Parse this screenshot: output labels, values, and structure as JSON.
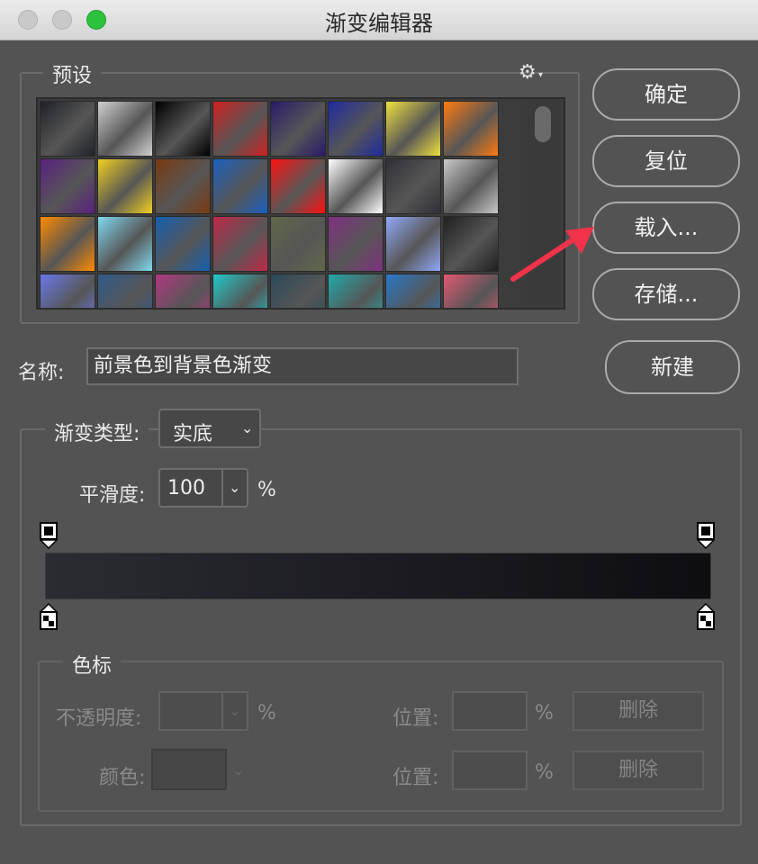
{
  "window": {
    "title": "渐变编辑器"
  },
  "presets": {
    "legend": "预设",
    "settings_icon": "gear-icon",
    "swatches": [
      [
        "#1e2228",
        "#cfcfcf",
        "#000000",
        "#d02020",
        "#2a1a6a",
        "#1e2aa0",
        "#f0e040",
        "#ff7a10"
      ],
      [
        "#5a2080",
        "#f0d020",
        "#7a3a10",
        "#1a60c0",
        "#ff1010",
        "#ffffff",
        "#303038",
        "#c8c8c8"
      ],
      [
        "#ff8a00",
        "#80d8f0",
        "#1460b0",
        "#c02848",
        "#606848",
        "#803080",
        "#90a8f8",
        "#202020"
      ],
      [
        "#6878e8",
        "#305a8a",
        "#b03880",
        "#20c8c8",
        "#2a4a5a",
        "#20a8a8",
        "#2878c8",
        "#e05870"
      ]
    ]
  },
  "buttons": {
    "ok": "确定",
    "reset": "复位",
    "load": "载入...",
    "save": "存储...",
    "new": "新建"
  },
  "name": {
    "label": "名称:",
    "value": "前景色到背景色渐变"
  },
  "gradient_type": {
    "label": "渐变类型:",
    "value": "实底",
    "smoothness_label": "平滑度:",
    "smoothness_value": "100",
    "unit": "%"
  },
  "gradient": {
    "start_color": "#2a2c32",
    "end_color": "#0e0d12"
  },
  "color_stops": {
    "legend": "色标",
    "opacity_label": "不透明度:",
    "opacity_unit": "%",
    "position_label_1": "位置:",
    "position_unit_1": "%",
    "delete_1": "删除",
    "color_label": "颜色:",
    "position_label_2": "位置:",
    "position_unit_2": "%",
    "delete_2": "删除"
  },
  "annotation_color": "#f0324a"
}
